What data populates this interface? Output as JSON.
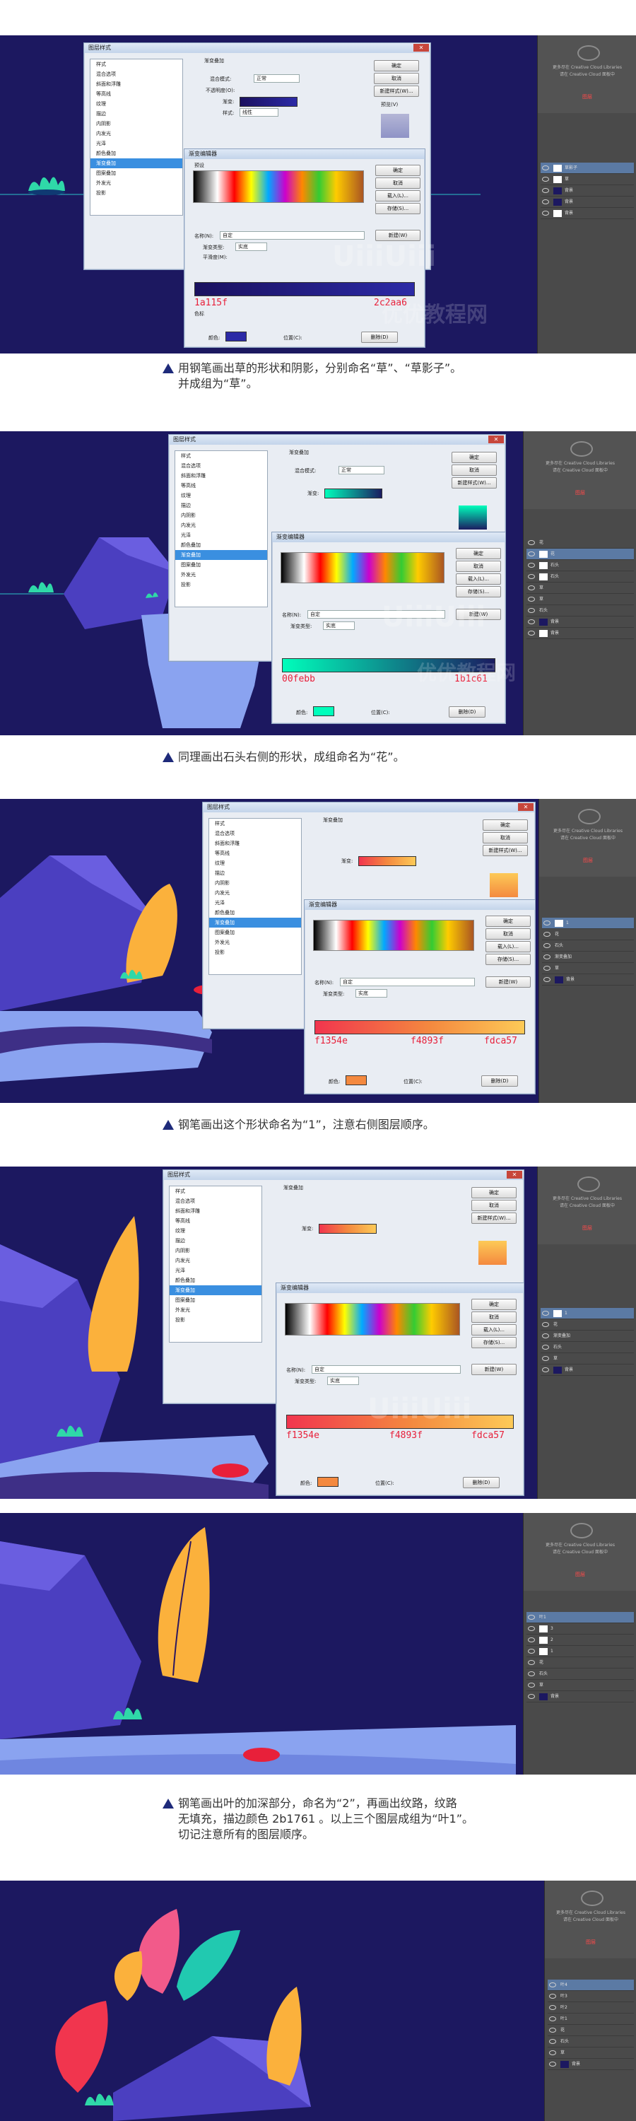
{
  "dialog": {
    "layer_style_title": "图层样式",
    "gradient_editor_title": "渐变编辑器",
    "styles_list": [
      "样式",
      "混合选项",
      "斜面和浮雕",
      "等高线",
      "纹理",
      "描边",
      "内阴影",
      "内发光",
      "光泽",
      "颜色叠加",
      "渐变叠加",
      "图案叠加",
      "外发光",
      "投影"
    ],
    "buttons_right": [
      "确定",
      "取消",
      "新建样式(W)...",
      "预览(V)"
    ],
    "buttons_grad": [
      "确定",
      "取消",
      "载入(L)...",
      "存储(S)...",
      "新建(W)"
    ],
    "labels": {
      "gradient_overlay": "渐变叠加",
      "gradient": "渐变",
      "blend_mode": "混合模式:",
      "normal": "正常",
      "dither": "仿色",
      "opacity": "不透明度(O):",
      "pct100": "100",
      "gradient_label": "渐变:",
      "reverse": "反向(R)",
      "style": "样式:",
      "linear": "线性",
      "align_layer": "与图层对齐(I)",
      "angle": "角度(N):",
      "reset_align": "重置对齐",
      "scale": "缩放(S):",
      "presets": "预设",
      "name": "名称(N):",
      "custom": "自定",
      "gradient_type": "渐变类型:",
      "solid": "实底",
      "smoothness": "平滑度(M):",
      "color_stop": "色标",
      "color": "颜色:",
      "location": "位置(C):",
      "delete": "删除(D)",
      "opacity_stop": "不透明度:"
    }
  },
  "layers_panel": {
    "info_line1": "更多尽在 Creative Cloud Libraries",
    "info_line2": "请在 Creative Cloud 面板中",
    "label": "图层",
    "panel1": [
      "草影子",
      "草",
      "背景",
      "背景",
      "背景"
    ],
    "panel2": [
      "花",
      "花",
      "石头",
      "石头",
      "草",
      "草",
      "石头",
      "背景",
      "背景"
    ],
    "panel3": [
      "1",
      "花",
      "石头",
      "渐变叠加",
      "草",
      "背景"
    ],
    "panel4": [
      "1",
      "花",
      "渐变叠加",
      "石头",
      "草",
      "背景"
    ],
    "panel5": [
      "叶1",
      "3",
      "2",
      "1",
      "花",
      "石头",
      "草",
      "背景"
    ],
    "panel6": [
      "叶4",
      "叶3",
      "叶2",
      "叶1",
      "花",
      "石头",
      "草",
      "背景"
    ]
  },
  "steps": [
    {
      "caption": [
        "用钢笔画出草的形状和阴影，分别命名“草”、“草影子”。",
        "并成组为“草”。"
      ],
      "color_left": "1a115f",
      "color_right": "2c2aa6"
    },
    {
      "caption": [
        "同理画出石头右侧的形状，成组命名为“花”。"
      ],
      "color_left": "00febb",
      "color_right": "1b1c61"
    },
    {
      "caption": [
        "钢笔画出这个形状命名为“1”，注意右侧图层顺序。"
      ],
      "color_left": "f1354e",
      "color_mid": "f4893f",
      "color_right": "fdca57"
    },
    {
      "color_left": "f1354e",
      "color_mid": "f4893f",
      "color_right": "fdca57"
    },
    {
      "caption": [
        "钢笔画出叶的加深部分，命名为“2”，再画出纹路，纹路",
        "无填充，描边颜色 2b1761 。以上三个图层成组为“叶1”。",
        "切记注意所有的图层顺序。"
      ]
    }
  ],
  "watermark": {
    "big": "UiiiUiii",
    "small": "优优教程网"
  },
  "colors": {
    "scene_bg": "#1c1860",
    "rock": "#4b3fc0",
    "grass": "#2fd8a8",
    "leaf_orange": "#fbb13c",
    "water": "#8aa3f0",
    "red": "#e8203a"
  }
}
